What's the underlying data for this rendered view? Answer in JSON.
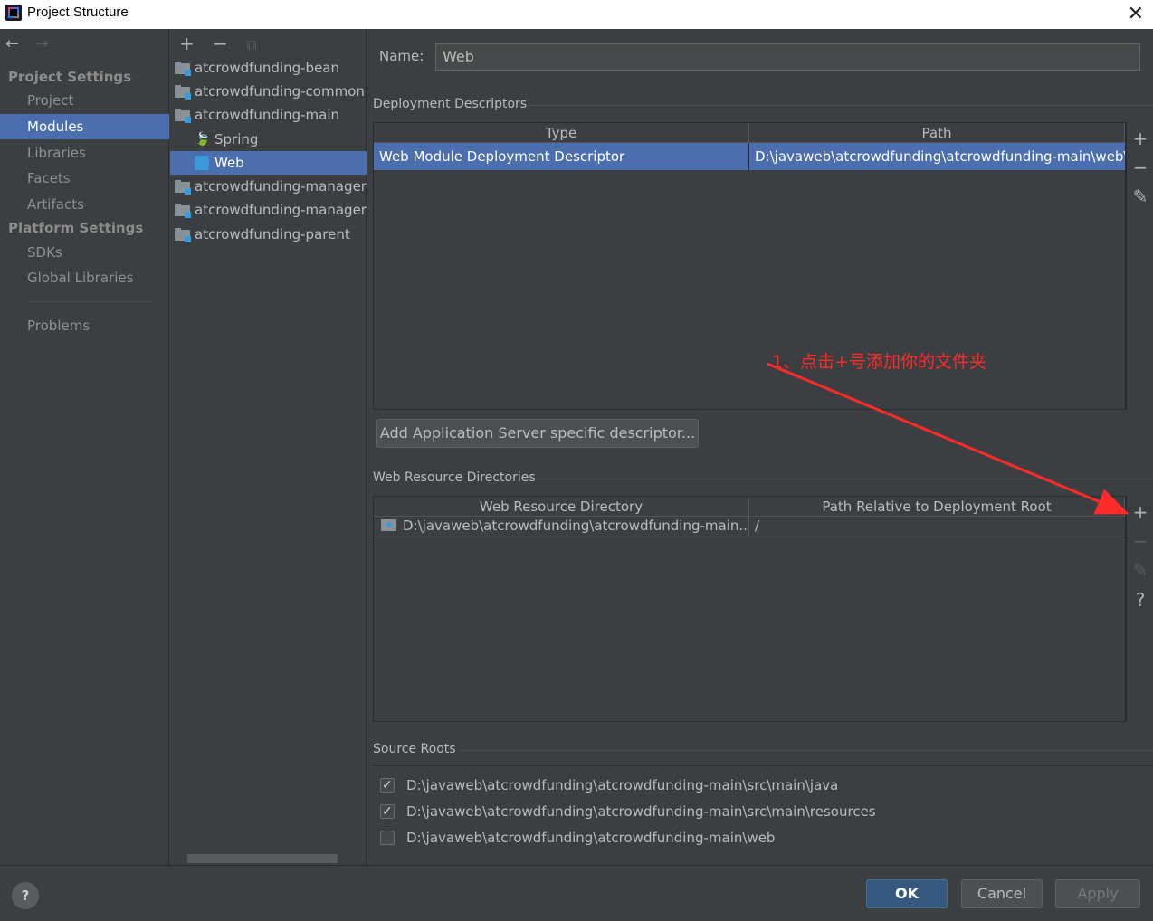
{
  "window": {
    "title": "Project Structure"
  },
  "nav": {
    "project_settings": "Project Settings",
    "items1": [
      "Project",
      "Modules",
      "Libraries",
      "Facets",
      "Artifacts"
    ],
    "platform_settings": "Platform Settings",
    "items2": [
      "SDKs",
      "Global Libraries"
    ],
    "problems": "Problems"
  },
  "tree": {
    "items": [
      "atcrowdfunding-bean",
      "atcrowdfunding-common",
      "atcrowdfunding-main",
      "Spring",
      "Web",
      "atcrowdfunding-manager-",
      "atcrowdfunding-manager-",
      "atcrowdfunding-parent"
    ]
  },
  "main": {
    "name_label": "Name:",
    "name_value": "Web",
    "deployment_descriptors": "Deployment Descriptors",
    "dd_table": {
      "headers": [
        "Type",
        "Path"
      ],
      "rows": [
        [
          "Web Module Deployment Descriptor",
          "D:\\javaweb\\atcrowdfunding\\atcrowdfunding-main\\web\\"
        ]
      ]
    },
    "add_server_descriptor": "Add Application Server specific descriptor...",
    "web_resource_directories": "Web Resource Directories",
    "wr_table": {
      "headers": [
        "Web Resource Directory",
        "Path Relative to Deployment Root"
      ],
      "rows": [
        [
          "D:\\javaweb\\atcrowdfunding\\atcrowdfunding-main...",
          "/"
        ]
      ]
    },
    "source_roots": "Source Roots",
    "source_root_items": [
      {
        "path": "D:\\javaweb\\atcrowdfunding\\atcrowdfunding-main\\src\\main\\java",
        "checked": true
      },
      {
        "path": "D:\\javaweb\\atcrowdfunding\\atcrowdfunding-main\\src\\main\\resources",
        "checked": true
      },
      {
        "path": "D:\\javaweb\\atcrowdfunding\\atcrowdfunding-main\\web",
        "checked": false
      }
    ]
  },
  "footer": {
    "ok": "OK",
    "cancel": "Cancel",
    "apply": "Apply",
    "help": "?"
  },
  "annotation": {
    "text": "1、点击+号添加你的文件夹",
    "color": "#ff2a2a"
  },
  "colors": {
    "selection": "#4b6eaf",
    "background": "#3c3f41",
    "ok_button": "#365880"
  }
}
